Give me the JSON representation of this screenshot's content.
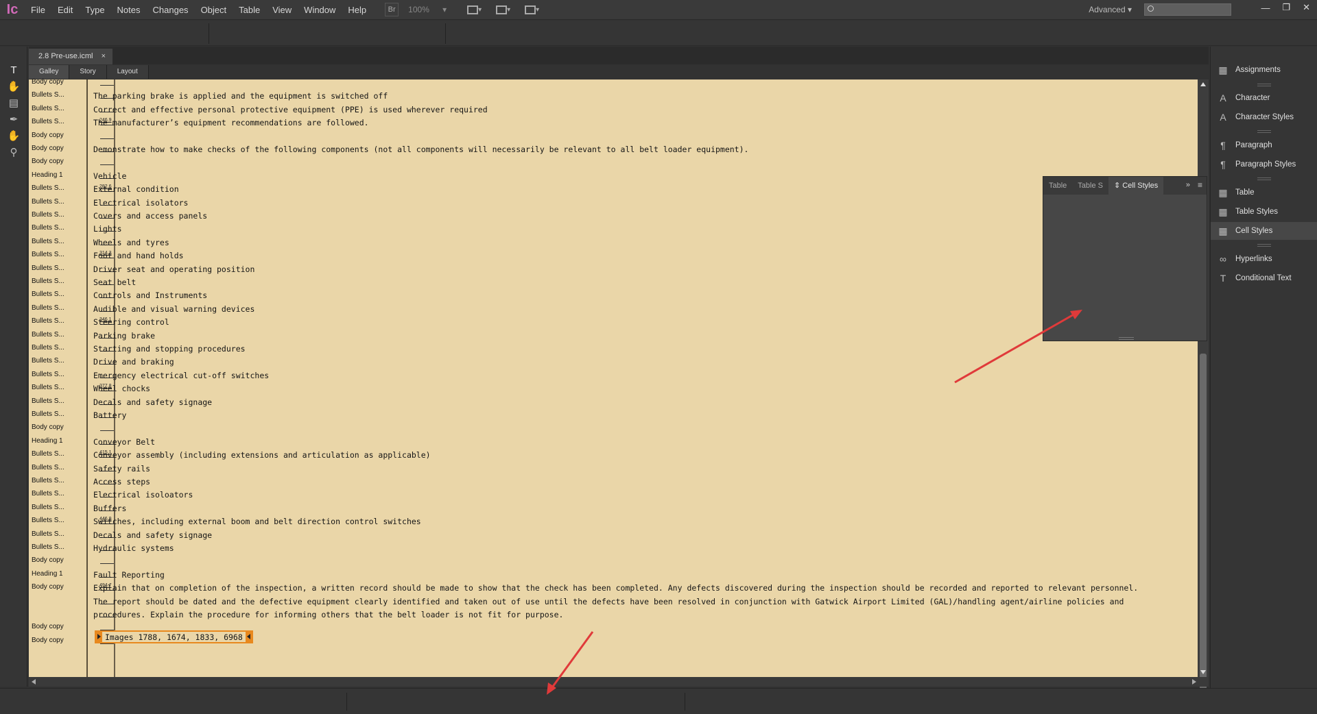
{
  "app": {
    "logo": "Ic",
    "menu": [
      "File",
      "Edit",
      "Type",
      "Notes",
      "Changes",
      "Object",
      "Table",
      "View",
      "Window",
      "Help"
    ],
    "bridge_label": "Br",
    "zoom": "100%",
    "workspace": "Advanced",
    "workspace_arrow": "▾"
  },
  "document": {
    "tab_title": "2.8 Pre-use.icml",
    "tab_close": "×",
    "view_tabs": [
      "Galley",
      "Story",
      "Layout"
    ]
  },
  "story": {
    "rows": [
      {
        "style": "Body copy",
        "text": ""
      },
      {
        "style": "Bullets S...",
        "text": "The parking brake is applied and the equipment is switched off"
      },
      {
        "style": "Bullets S...",
        "text": "Correct and effective personal protective equipment (PPE) is used wherever required"
      },
      {
        "style": "Bullets S...",
        "text": "The manufacturer’s equipment recommendations are followed."
      },
      {
        "style": "Body copy",
        "text": ""
      },
      {
        "style": "Body copy",
        "text": "Demonstrate how to make checks of the following components (not all components will necessarily be relevant to all belt loader equipment)."
      },
      {
        "style": "Body copy",
        "text": ""
      },
      {
        "style": "Heading 1",
        "text": "Vehicle"
      },
      {
        "style": "Bullets S...",
        "text": "External condition"
      },
      {
        "style": "Bullets S...",
        "text": "Electrical isolators"
      },
      {
        "style": "Bullets S...",
        "text": "Covers and access panels"
      },
      {
        "style": "Bullets S...",
        "text": "Lights"
      },
      {
        "style": "Bullets S...",
        "text": "Wheels and tyres"
      },
      {
        "style": "Bullets S...",
        "text": "Foot and hand holds"
      },
      {
        "style": "Bullets S...",
        "text": "Driver seat and operating position"
      },
      {
        "style": "Bullets S...",
        "text": "Seat belt"
      },
      {
        "style": "Bullets S...",
        "text": "Controls and Instruments"
      },
      {
        "style": "Bullets S...",
        "text": "Audible and visual warning devices"
      },
      {
        "style": "Bullets S...",
        "text": "Steering control"
      },
      {
        "style": "Bullets S...",
        "text": "Parking brake"
      },
      {
        "style": "Bullets S...",
        "text": "Starting and stopping procedures"
      },
      {
        "style": "Bullets S...",
        "text": "Drive and braking"
      },
      {
        "style": "Bullets S...",
        "text": "Emergency electrical cut-off switches"
      },
      {
        "style": "Bullets S...",
        "text": "Wheel chocks"
      },
      {
        "style": "Bullets S...",
        "text": "Decals and safety signage"
      },
      {
        "style": "Bullets S...",
        "text": "Battery"
      },
      {
        "style": "Body copy",
        "text": ""
      },
      {
        "style": "Heading 1",
        "text": "Conveyor Belt"
      },
      {
        "style": "Bullets S...",
        "text": "Conveyor assembly (including extensions and articulation as applicable)"
      },
      {
        "style": "Bullets S...",
        "text": "Safety rails"
      },
      {
        "style": "Bullets S...",
        "text": "Access steps"
      },
      {
        "style": "Bullets S...",
        "text": "Electrical isoloators"
      },
      {
        "style": "Bullets S...",
        "text": "Buffers"
      },
      {
        "style": "Bullets S...",
        "text": "Switches, including external boom and belt direction control switches"
      },
      {
        "style": "Bullets S...",
        "text": "Decals and safety signage"
      },
      {
        "style": "Bullets S...",
        "text": "Hydraulic systems"
      },
      {
        "style": "Body copy",
        "text": ""
      },
      {
        "style": "Heading 1",
        "text": "Fault Reporting"
      },
      {
        "style": "Body copy",
        "text": "Explain that on completion of the inspection, a written record should be made to show that the check has been completed. Any defects discovered during the inspection should be recorded and reported to relevant personnel."
      },
      {
        "style": "",
        "text": "The report should be dated and the defective equipment clearly identified and taken out of use until the defects have been resolved in conjunction with Gatwick Airport Limited (GAL)/handling agent/airline policies and"
      },
      {
        "style": "",
        "text": "procedures. Explain the procedure for informing others that the belt loader is not fit for purpose."
      },
      {
        "style": "Body copy",
        "text": ""
      },
      {
        "style": "Body copy",
        "text": ""
      }
    ],
    "depth_marks": [
      "246.9",
      "282.6",
      "314.3",
      "346.1",
      "377.8",
      "415.1",
      "446.9",
      "494.7"
    ],
    "image_tag": "Images 1788, 1674, 1833, 6968"
  },
  "float_panel": {
    "tabs": [
      "Table",
      "Table S",
      "Cell Styles"
    ],
    "collapse": "»",
    "menu": "≡"
  },
  "dock": {
    "items": [
      {
        "label": "Assignments",
        "icon": "assignments-icon"
      },
      {
        "label": "Character",
        "icon": "character-icon"
      },
      {
        "label": "Character Styles",
        "icon": "character-styles-icon"
      },
      {
        "label": "Paragraph",
        "icon": "paragraph-icon"
      },
      {
        "label": "Paragraph Styles",
        "icon": "paragraph-styles-icon"
      },
      {
        "label": "Table",
        "icon": "table-icon"
      },
      {
        "label": "Table Styles",
        "icon": "table-styles-icon"
      },
      {
        "label": "Cell Styles",
        "icon": "cell-styles-icon"
      },
      {
        "label": "Hyperlinks",
        "icon": "hyperlinks-icon"
      },
      {
        "label": "Conditional Text",
        "icon": "conditional-text-icon"
      }
    ],
    "active": "Cell Styles"
  },
  "colors": {
    "story_bg": "#ead6a8",
    "ui_dark": "#323232",
    "annotation_arrow": "#e03a3a",
    "tag_accent": "#e8891e"
  }
}
